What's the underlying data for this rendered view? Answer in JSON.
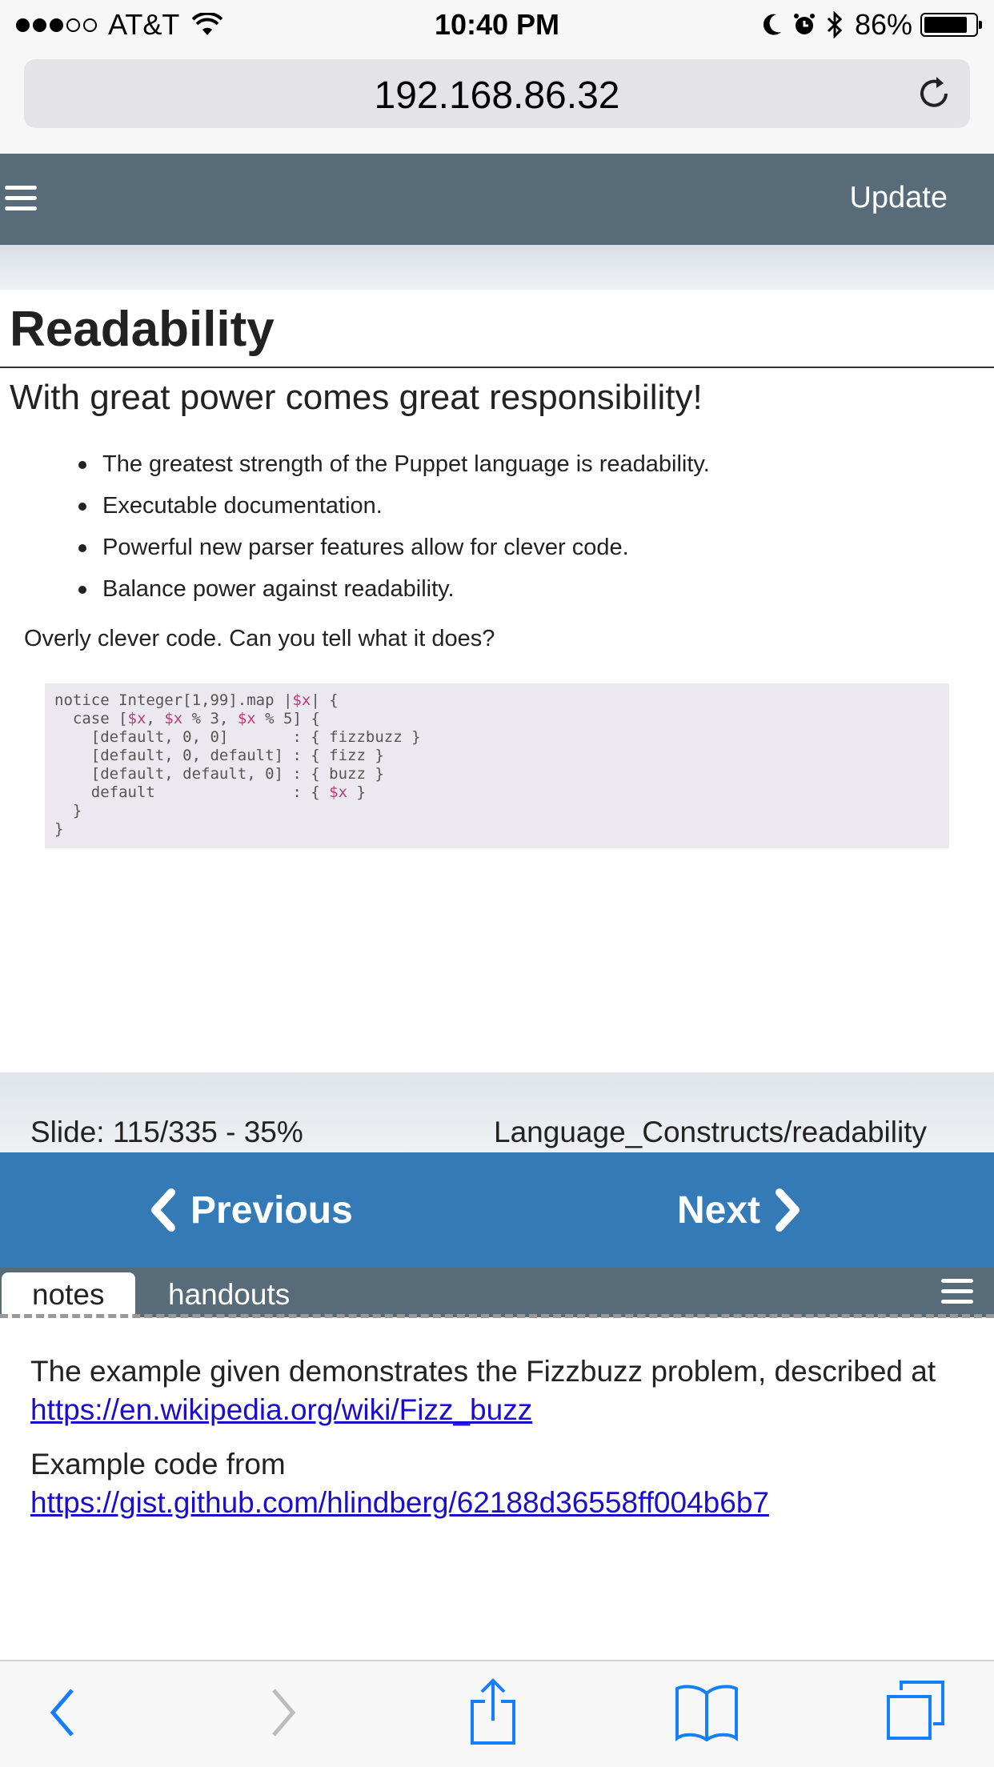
{
  "status_bar": {
    "carrier": "AT&T",
    "time": "10:40 PM",
    "battery_percent": "86%",
    "battery_level": 0.86,
    "signal_bars": 3
  },
  "browser": {
    "url": "192.168.86.32"
  },
  "app_header": {
    "update_label": "Update"
  },
  "slide": {
    "title": "Readability",
    "subtitle": "With great power comes great responsibility!",
    "bullets": [
      "The greatest strength of the Puppet language is readability.",
      "Executable documentation.",
      "Powerful new parser features allow for clever code.",
      "Balance power against readability."
    ],
    "question": "Overly clever code. Can you tell what it does?",
    "code": [
      "notice Integer[1,99].map |$x| {",
      "  case [$x, $x % 3, $x % 5] {",
      "    [default, 0, 0]       : { fizzbuzz }",
      "    [default, 0, default] : { fizz }",
      "    [default, default, 0] : { buzz }",
      "    default               : { $x }",
      "  }",
      "}"
    ]
  },
  "footer": {
    "slide_number": "Slide: 115/335 - 35%",
    "slide_path": "Language_Constructs/readability"
  },
  "navigation": {
    "previous_label": "Previous",
    "next_label": "Next"
  },
  "tabs": {
    "notes_label": "notes",
    "handouts_label": "handouts"
  },
  "notes": {
    "paragraph1_text": "The example given demonstrates the Fizzbuzz problem, described at ",
    "paragraph1_link": "https://en.wikipedia.org/wiki/Fizz_buzz",
    "paragraph2_text": "Example code from ",
    "paragraph2_link": "https://gist.github.com/hlindberg/62188d36558ff004b6b7"
  },
  "icons": {
    "back": "chevron-left-icon",
    "forward": "chevron-right-icon",
    "share": "share-icon",
    "bookmarks": "book-icon",
    "tabs": "tabs-icon"
  },
  "colors": {
    "header_bg": "#576c78",
    "nav_bg": "#337ab7",
    "link": "#1a0dcc",
    "ios_blue": "#147efb",
    "code_var": "#c2397b"
  }
}
